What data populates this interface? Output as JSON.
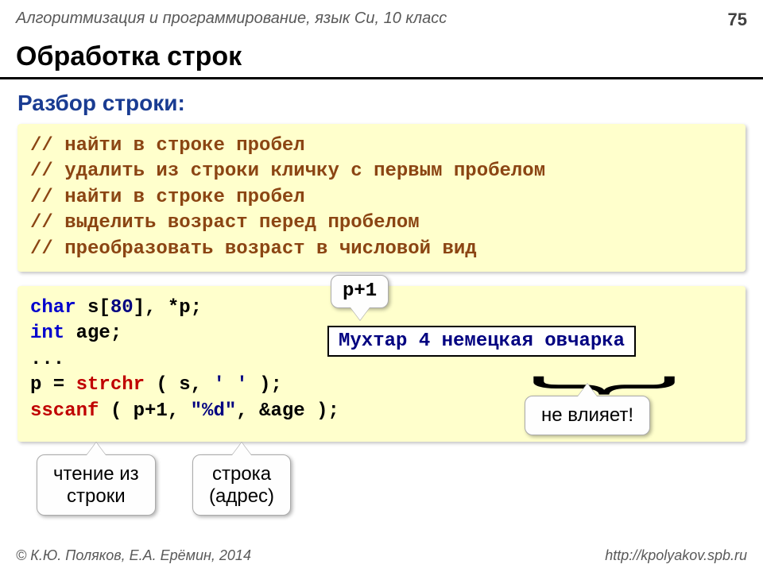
{
  "header": {
    "course": "Алгоритмизация и программирование, язык Си, 10 класс",
    "page": "75"
  },
  "title": "Обработка строк",
  "subtitle": "Разбор строки:",
  "comments": [
    "// найти в строке пробел",
    "// удалить из строки кличку с первым пробелом",
    "// найти в строке пробел",
    "// выделить возраст перед пробелом",
    "// преобразовать возраст в числовой вид"
  ],
  "code": {
    "l1a": "char",
    "l1b": " s[",
    "l1c": "80",
    "l1d": "], *p;",
    "l2a": "int",
    "l2b": " age;",
    "l3": "...",
    "l4a": "p = ",
    "l4b": "strchr",
    "l4c": " ( s, ",
    "l4d": "' '",
    "l4e": " );",
    "l5a": "sscanf",
    "l5b": " ( p+1, ",
    "l5c": "\"%d\"",
    "l5d": ", &age );"
  },
  "example": "Мухтар 4 немецкая овчарка",
  "callouts": {
    "ptr": "p+1",
    "noeffect": "не влияет!",
    "read1": "чтение из",
    "read2": "строки",
    "addr1": "строка",
    "addr2": "(адрес)"
  },
  "footer": {
    "left": "© К.Ю. Поляков, Е.А. Ерёмин, 2014",
    "right": "http://kpolyakov.spb.ru"
  }
}
